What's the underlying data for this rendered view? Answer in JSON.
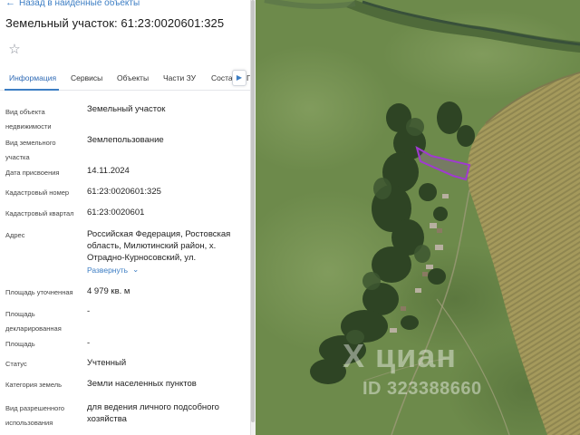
{
  "panel": {
    "back_label": "Назад в найденные объекты",
    "title": "Земельный участок: 61:23:0020601:325",
    "favorite_icon": "star-icon"
  },
  "tabs": [
    {
      "label": "Информация",
      "active": true
    },
    {
      "label": "Сервисы",
      "active": false
    },
    {
      "label": "Объекты",
      "active": false
    },
    {
      "label": "Части ЗУ",
      "active": false
    },
    {
      "label": "Соста",
      "active": false
    },
    {
      "label": "Г",
      "active": false
    }
  ],
  "fields": [
    {
      "label": "Вид объекта недвижимости",
      "value": "Земельный участок"
    },
    {
      "label": "Вид земельного участка",
      "value": "Землепользование"
    },
    {
      "label": "Дата присвоения",
      "value": "14.11.2024"
    },
    {
      "label": "Кадастровый номер",
      "value": "61:23:0020601:325"
    },
    {
      "label": "Кадастровый квартал",
      "value": "61:23:0020601"
    },
    {
      "label": "Адрес",
      "value": "Российская Федерация, Ростовская область, Милютинский район, х. Отрадно-Курносовский, ул."
    },
    {
      "label": "Площадь уточненная",
      "value": "4 979 кв. м"
    },
    {
      "label": "Площадь декларированная",
      "value": "-"
    },
    {
      "label": "Площадь",
      "value": "-"
    },
    {
      "label": "Статус",
      "value": "Учтенный"
    },
    {
      "label": "Категория земель",
      "value": "Земли населенных пунктов"
    },
    {
      "label": "Вид разрешенного использования",
      "value": "для ведения личного подсобного хозяйства"
    }
  ],
  "expand_label": "Развернуть",
  "map": {
    "watermark_logo": "Х циан",
    "watermark_id": "ID 323388660",
    "parcel_color": "#a03ad0"
  }
}
